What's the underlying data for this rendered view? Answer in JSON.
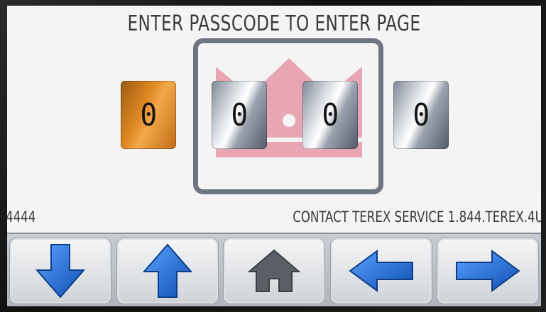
{
  "prompt": {
    "title": "ENTER PASSCODE TO ENTER PAGE"
  },
  "passcode": {
    "digits": [
      "0",
      "0",
      "0",
      "0"
    ],
    "active_index": 0,
    "colors": {
      "active": "#e08a24",
      "inactive": "#c9ced4"
    }
  },
  "footer": {
    "code": "4444",
    "contact": "CONTACT TEREX SERVICE 1.844.TEREX.4U"
  },
  "nav": {
    "buttons": [
      {
        "icon": "arrow-down-icon"
      },
      {
        "icon": "arrow-up-icon"
      },
      {
        "icon": "home-icon"
      },
      {
        "icon": "arrow-left-icon"
      },
      {
        "icon": "arrow-right-icon"
      }
    ],
    "arrow_color": "#1f6fd6",
    "home_color": "#5a5f66"
  }
}
